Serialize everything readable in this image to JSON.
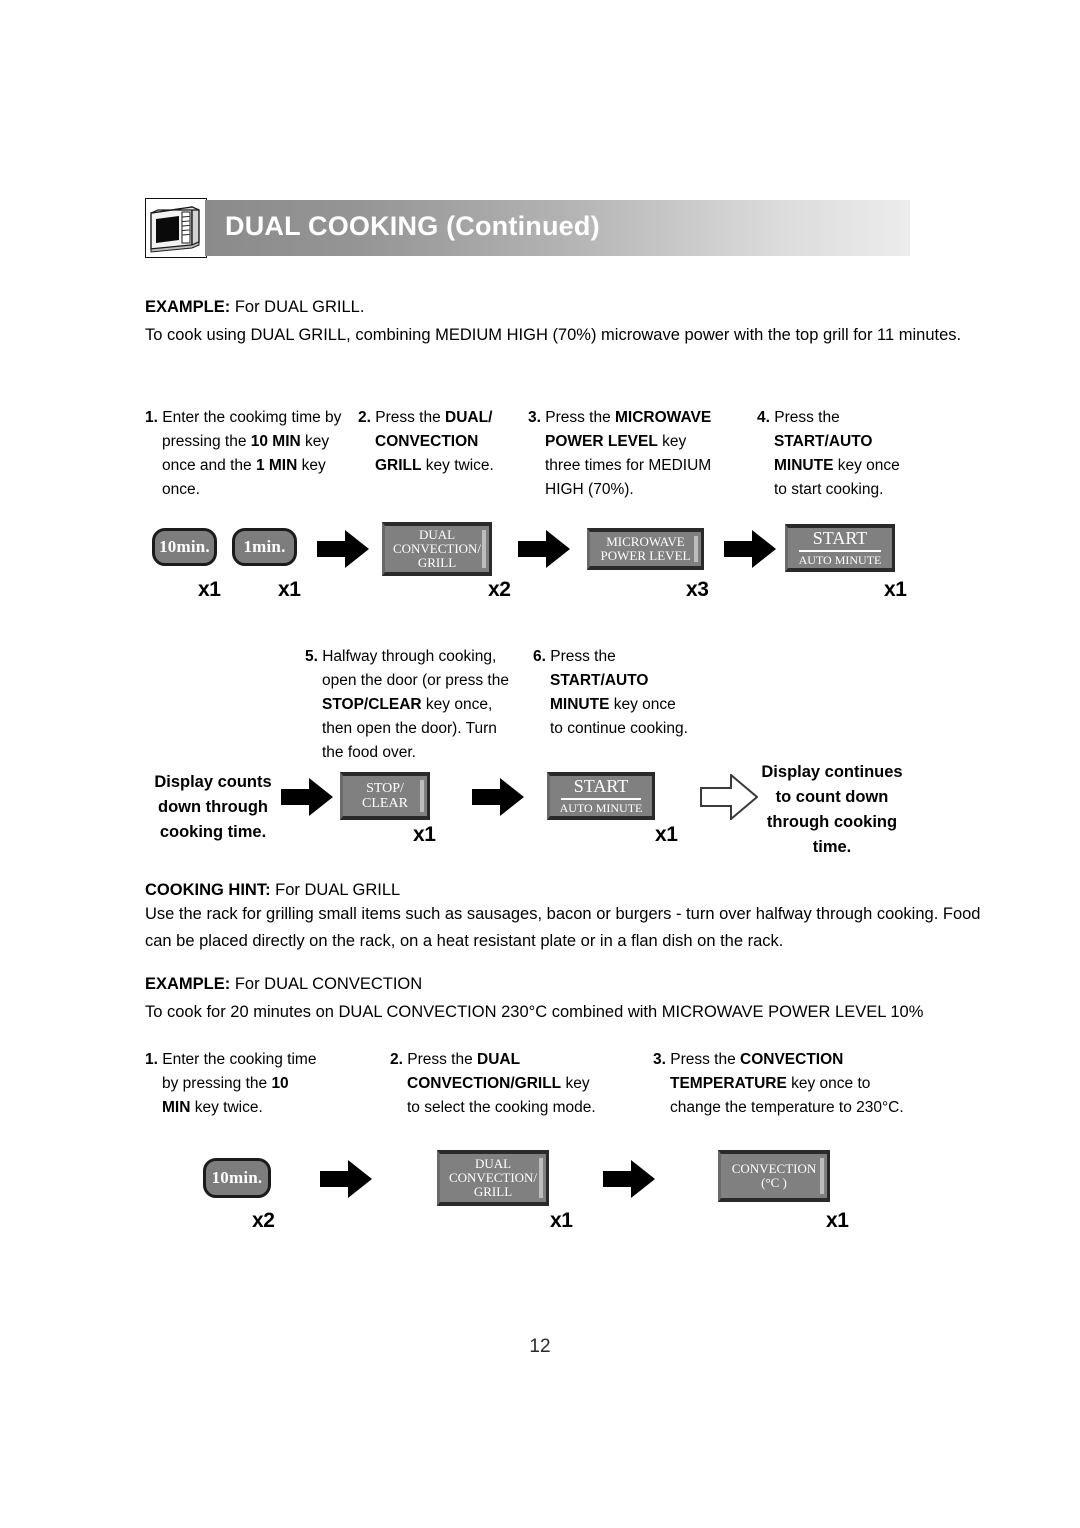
{
  "header": {
    "title": "DUAL COOKING (Continued)",
    "icon": "microwave-oven-icon",
    "gradient_from": "#8b8b8b",
    "gradient_to": "#ececec"
  },
  "example1": {
    "label": "EXAMPLE:",
    "subject": " For DUAL GRILL.",
    "description": "To cook using DUAL GRILL, combining MEDIUM HIGH (70%) microwave power with the top grill for 11 minutes."
  },
  "steps1": [
    {
      "num": "1.",
      "lines": [
        [
          {
            "t": "Enter the cookimg time by",
            "b": false
          }
        ],
        [
          {
            "t": "pressing the ",
            "b": false
          },
          {
            "t": "10 MIN",
            "b": true
          },
          {
            "t": " key",
            "b": false
          }
        ],
        [
          {
            "t": "once and the ",
            "b": false
          },
          {
            "t": "1 MIN",
            "b": true
          },
          {
            "t": " key",
            "b": false
          }
        ],
        [
          {
            "t": "once.",
            "b": false
          }
        ]
      ]
    },
    {
      "num": "2.",
      "lines": [
        [
          {
            "t": "Press the ",
            "b": false
          },
          {
            "t": "DUAL/",
            "b": true
          }
        ],
        [
          {
            "t": "CONVECTION",
            "b": true
          }
        ],
        [
          {
            "t": "GRILL",
            "b": true
          },
          {
            "t": " key twice.",
            "b": false
          }
        ]
      ]
    },
    {
      "num": "3.",
      "lines": [
        [
          {
            "t": "Press the ",
            "b": false
          },
          {
            "t": "MICROWAVE",
            "b": true
          }
        ],
        [
          {
            "t": "POWER LEVEL",
            "b": true
          },
          {
            "t": " key",
            "b": false
          }
        ],
        [
          {
            "t": "three times for MEDIUM",
            "b": false
          }
        ],
        [
          {
            "t": "HIGH (70%).",
            "b": false
          }
        ]
      ]
    },
    {
      "num": "4.",
      "lines": [
        [
          {
            "t": "Press the",
            "b": false
          }
        ],
        [
          {
            "t": "START/AUTO",
            "b": true
          }
        ],
        [
          {
            "t": "MINUTE",
            "b": true
          },
          {
            "t": " key once",
            "b": false
          }
        ],
        [
          {
            "t": "to start cooking.",
            "b": false
          }
        ]
      ]
    }
  ],
  "flow1": {
    "keys": [
      {
        "name": "key-10min",
        "type": "time",
        "lines": [
          "10min."
        ],
        "count": "x1"
      },
      {
        "name": "key-1min",
        "type": "time",
        "lines": [
          "1min."
        ],
        "count": "x1"
      },
      {
        "name": "key-dual-convection-grill",
        "type": "panel",
        "lines": [
          "DUAL",
          "CONVECTION/",
          "GRILL"
        ],
        "count": "x2"
      },
      {
        "name": "key-microwave-power-level",
        "type": "panel",
        "lines": [
          "MICROWAVE",
          "POWER LEVEL"
        ],
        "count": "x3"
      },
      {
        "name": "key-start-auto-minute",
        "type": "panel",
        "lines": [
          "START",
          "AUTO MINUTE"
        ],
        "rule": true,
        "count": "x1"
      }
    ]
  },
  "steps2": [
    {
      "num": "5.",
      "lines": [
        [
          {
            "t": "Halfway through cooking,",
            "b": false
          }
        ],
        [
          {
            "t": "open the door (or press the",
            "b": false
          }
        ],
        [
          {
            "t": "STOP/CLEAR",
            "b": true
          },
          {
            "t": " key once,",
            "b": false
          }
        ],
        [
          {
            "t": "then open the door). Turn",
            "b": false
          }
        ],
        [
          {
            "t": "the food over.",
            "b": false
          }
        ]
      ]
    },
    {
      "num": "6.",
      "lines": [
        [
          {
            "t": "Press the",
            "b": false
          }
        ],
        [
          {
            "t": "START/AUTO",
            "b": true
          }
        ],
        [
          {
            "t": "MINUTE",
            "b": true
          },
          {
            "t": " key once",
            "b": false
          }
        ],
        [
          {
            "t": "to continue cooking.",
            "b": false
          }
        ]
      ]
    }
  ],
  "flow2": {
    "caption_left": [
      "Display counts",
      "down through",
      "cooking time."
    ],
    "caption_right": [
      "Display continues",
      "to count down",
      "through cooking",
      "time."
    ],
    "keys": [
      {
        "name": "key-stop-clear",
        "type": "panel",
        "lines": [
          "STOP/",
          "CLEAR"
        ],
        "count": "x1"
      },
      {
        "name": "key-start-auto-minute",
        "type": "panel",
        "lines": [
          "START",
          "AUTO MINUTE"
        ],
        "rule": true,
        "count": "x1"
      }
    ]
  },
  "hint": {
    "label": "COOKING HINT:",
    "subject": " For DUAL GRILL",
    "line1": "Use the rack for grilling small items such as sausages, bacon or burgers - turn over halfway through cooking. Food",
    "line2": "can be placed directly on the rack, on a heat resistant plate or in a flan dish on the rack."
  },
  "example2": {
    "label": "EXAMPLE:",
    "subject": " For DUAL CONVECTION",
    "description": "To cook for 20 minutes on DUAL CONVECTION 230°C combined with MICROWAVE POWER LEVEL 10%"
  },
  "steps3": [
    {
      "num": "1.",
      "lines": [
        [
          {
            "t": "Enter the cooking time",
            "b": false
          }
        ],
        [
          {
            "t": "by pressing the ",
            "b": false
          },
          {
            "t": "10",
            "b": true
          }
        ],
        [
          {
            "t": "MIN",
            "b": true
          },
          {
            "t": " key twice.",
            "b": false
          }
        ]
      ]
    },
    {
      "num": "2.",
      "lines": [
        [
          {
            "t": "Press the ",
            "b": false
          },
          {
            "t": "DUAL",
            "b": true
          }
        ],
        [
          {
            "t": "CONVECTION/GRILL",
            "b": true
          },
          {
            "t": " key",
            "b": false
          }
        ],
        [
          {
            "t": "to select the cooking mode.",
            "b": false
          }
        ]
      ]
    },
    {
      "num": "3.",
      "lines": [
        [
          {
            "t": "Press the ",
            "b": false
          },
          {
            "t": "CONVECTION",
            "b": true
          }
        ],
        [
          {
            "t": "TEMPERATURE",
            "b": true
          },
          {
            "t": " key once to",
            "b": false
          }
        ],
        [
          {
            "t": "change the temperature to 230°C.",
            "b": false
          }
        ]
      ]
    }
  ],
  "flow3": {
    "keys": [
      {
        "name": "key-10min",
        "type": "time",
        "lines": [
          "10min."
        ],
        "count": "x2"
      },
      {
        "name": "key-dual-convection-grill",
        "type": "panel",
        "lines": [
          "DUAL",
          "CONVECTION/",
          "GRILL"
        ],
        "count": "x1"
      },
      {
        "name": "key-convection-temperature",
        "type": "panel",
        "lines": [
          "CONVECTION",
          "(°C )"
        ],
        "count": "x1"
      }
    ]
  },
  "footer": {
    "page_number": "12"
  }
}
